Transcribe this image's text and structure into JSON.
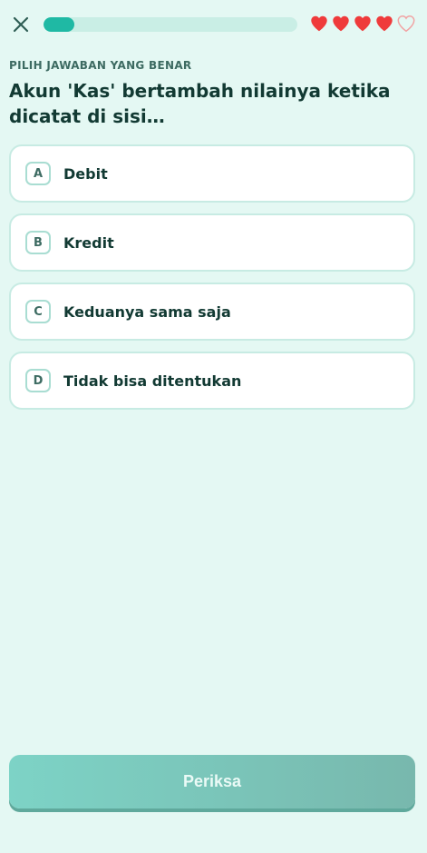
{
  "header": {
    "close_icon": "close-icon",
    "progress_fraction": 0.12,
    "progress_color": "#1fb9a4",
    "lives": [
      {
        "filled": true
      },
      {
        "filled": true
      },
      {
        "filled": true
      },
      {
        "filled": true
      },
      {
        "filled": false
      }
    ],
    "heart_color": "#ef3b3b"
  },
  "quiz": {
    "instruction": "PILIH JAWABAN YANG BENAR",
    "question": "Akun 'Kas' bertambah nilainya ketika dicatat di sisi…",
    "options": [
      {
        "letter": "A",
        "label": "Debit"
      },
      {
        "letter": "B",
        "label": "Kredit"
      },
      {
        "letter": "C",
        "label": "Keduanya sama saja"
      },
      {
        "letter": "D",
        "label": "Tidak bisa ditentukan"
      }
    ]
  },
  "footer": {
    "check_label": "Periksa"
  }
}
